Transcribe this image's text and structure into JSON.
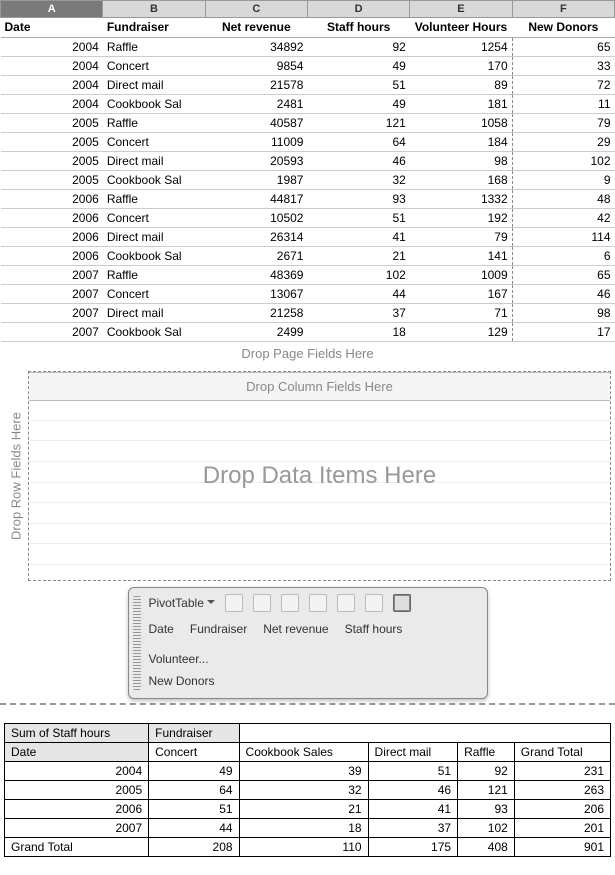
{
  "columns": [
    "A",
    "B",
    "C",
    "D",
    "E",
    "F"
  ],
  "headers": {
    "date": "Date",
    "fundraiser": "Fundraiser",
    "net_revenue": "Net revenue",
    "staff_hours": "Staff hours",
    "volunteer_hours": "Volunteer Hours",
    "new_donors": "New Donors"
  },
  "rows": [
    {
      "date": "2004",
      "fundraiser": "Raffle",
      "net": "34892",
      "staff": "92",
      "vol": "1254",
      "donors": "65"
    },
    {
      "date": "2004",
      "fundraiser": "Concert",
      "net": "9854",
      "staff": "49",
      "vol": "170",
      "donors": "33"
    },
    {
      "date": "2004",
      "fundraiser": "Direct mail",
      "net": "21578",
      "staff": "51",
      "vol": "89",
      "donors": "72"
    },
    {
      "date": "2004",
      "fundraiser": "Cookbook Sal",
      "net": "2481",
      "staff": "49",
      "vol": "181",
      "donors": "11"
    },
    {
      "date": "2005",
      "fundraiser": "Raffle",
      "net": "40587",
      "staff": "121",
      "vol": "1058",
      "donors": "79"
    },
    {
      "date": "2005",
      "fundraiser": "Concert",
      "net": "11009",
      "staff": "64",
      "vol": "184",
      "donors": "29"
    },
    {
      "date": "2005",
      "fundraiser": "Direct mail",
      "net": "20593",
      "staff": "46",
      "vol": "98",
      "donors": "102"
    },
    {
      "date": "2005",
      "fundraiser": "Cookbook Sal",
      "net": "1987",
      "staff": "32",
      "vol": "168",
      "donors": "9"
    },
    {
      "date": "2006",
      "fundraiser": "Raffle",
      "net": "44817",
      "staff": "93",
      "vol": "1332",
      "donors": "48"
    },
    {
      "date": "2006",
      "fundraiser": "Concert",
      "net": "10502",
      "staff": "51",
      "vol": "192",
      "donors": "42"
    },
    {
      "date": "2006",
      "fundraiser": "Direct mail",
      "net": "26314",
      "staff": "41",
      "vol": "79",
      "donors": "114"
    },
    {
      "date": "2006",
      "fundraiser": "Cookbook Sal",
      "net": "2671",
      "staff": "21",
      "vol": "141",
      "donors": "6"
    },
    {
      "date": "2007",
      "fundraiser": "Raffle",
      "net": "48369",
      "staff": "102",
      "vol": "1009",
      "donors": "65"
    },
    {
      "date": "2007",
      "fundraiser": "Concert",
      "net": "13067",
      "staff": "44",
      "vol": "167",
      "donors": "46"
    },
    {
      "date": "2007",
      "fundraiser": "Direct mail",
      "net": "21258",
      "staff": "37",
      "vol": "71",
      "donors": "98"
    },
    {
      "date": "2007",
      "fundraiser": "Cookbook Sal",
      "net": "2499",
      "staff": "18",
      "vol": "129",
      "donors": "17"
    }
  ],
  "dropzone": {
    "page": "Drop Page Fields Here",
    "columns": "Drop Column Fields Here",
    "rows": "Drop Row Fields Here",
    "data": "Drop Data Items Here"
  },
  "toolbar": {
    "menu": "PivotTable",
    "fields": [
      "Date",
      "Fundraiser",
      "Net revenue",
      "Staff hours",
      "Volunteer..."
    ],
    "fields2": [
      "New Donors"
    ]
  },
  "pivot": {
    "measure": "Sum of Staff hours",
    "col_field": "Fundraiser",
    "row_field": "Date",
    "columns": [
      "Concert",
      "Cookbook Sales",
      "Direct mail",
      "Raffle",
      "Grand Total"
    ],
    "rows": [
      {
        "date": "2004",
        "v": [
          "49",
          "39",
          "51",
          "92",
          "231"
        ]
      },
      {
        "date": "2005",
        "v": [
          "64",
          "32",
          "46",
          "121",
          "263"
        ]
      },
      {
        "date": "2006",
        "v": [
          "51",
          "21",
          "41",
          "93",
          "206"
        ]
      },
      {
        "date": "2007",
        "v": [
          "44",
          "18",
          "37",
          "102",
          "201"
        ]
      }
    ],
    "grand": {
      "label": "Grand Total",
      "v": [
        "208",
        "110",
        "175",
        "408",
        "901"
      ]
    }
  }
}
